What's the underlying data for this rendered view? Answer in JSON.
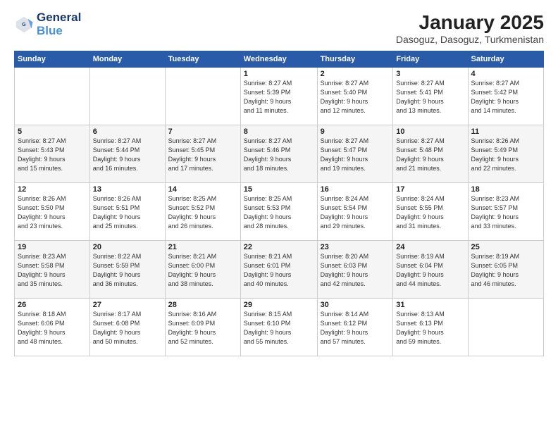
{
  "logo": {
    "line1": "General",
    "line2": "Blue"
  },
  "title": "January 2025",
  "subtitle": "Dasoguz, Dasoguz, Turkmenistan",
  "weekdays": [
    "Sunday",
    "Monday",
    "Tuesday",
    "Wednesday",
    "Thursday",
    "Friday",
    "Saturday"
  ],
  "weeks": [
    [
      {
        "day": "",
        "info": ""
      },
      {
        "day": "",
        "info": ""
      },
      {
        "day": "",
        "info": ""
      },
      {
        "day": "1",
        "info": "Sunrise: 8:27 AM\nSunset: 5:39 PM\nDaylight: 9 hours\nand 11 minutes."
      },
      {
        "day": "2",
        "info": "Sunrise: 8:27 AM\nSunset: 5:40 PM\nDaylight: 9 hours\nand 12 minutes."
      },
      {
        "day": "3",
        "info": "Sunrise: 8:27 AM\nSunset: 5:41 PM\nDaylight: 9 hours\nand 13 minutes."
      },
      {
        "day": "4",
        "info": "Sunrise: 8:27 AM\nSunset: 5:42 PM\nDaylight: 9 hours\nand 14 minutes."
      }
    ],
    [
      {
        "day": "5",
        "info": "Sunrise: 8:27 AM\nSunset: 5:43 PM\nDaylight: 9 hours\nand 15 minutes."
      },
      {
        "day": "6",
        "info": "Sunrise: 8:27 AM\nSunset: 5:44 PM\nDaylight: 9 hours\nand 16 minutes."
      },
      {
        "day": "7",
        "info": "Sunrise: 8:27 AM\nSunset: 5:45 PM\nDaylight: 9 hours\nand 17 minutes."
      },
      {
        "day": "8",
        "info": "Sunrise: 8:27 AM\nSunset: 5:46 PM\nDaylight: 9 hours\nand 18 minutes."
      },
      {
        "day": "9",
        "info": "Sunrise: 8:27 AM\nSunset: 5:47 PM\nDaylight: 9 hours\nand 19 minutes."
      },
      {
        "day": "10",
        "info": "Sunrise: 8:27 AM\nSunset: 5:48 PM\nDaylight: 9 hours\nand 21 minutes."
      },
      {
        "day": "11",
        "info": "Sunrise: 8:26 AM\nSunset: 5:49 PM\nDaylight: 9 hours\nand 22 minutes."
      }
    ],
    [
      {
        "day": "12",
        "info": "Sunrise: 8:26 AM\nSunset: 5:50 PM\nDaylight: 9 hours\nand 23 minutes."
      },
      {
        "day": "13",
        "info": "Sunrise: 8:26 AM\nSunset: 5:51 PM\nDaylight: 9 hours\nand 25 minutes."
      },
      {
        "day": "14",
        "info": "Sunrise: 8:25 AM\nSunset: 5:52 PM\nDaylight: 9 hours\nand 26 minutes."
      },
      {
        "day": "15",
        "info": "Sunrise: 8:25 AM\nSunset: 5:53 PM\nDaylight: 9 hours\nand 28 minutes."
      },
      {
        "day": "16",
        "info": "Sunrise: 8:24 AM\nSunset: 5:54 PM\nDaylight: 9 hours\nand 29 minutes."
      },
      {
        "day": "17",
        "info": "Sunrise: 8:24 AM\nSunset: 5:55 PM\nDaylight: 9 hours\nand 31 minutes."
      },
      {
        "day": "18",
        "info": "Sunrise: 8:23 AM\nSunset: 5:57 PM\nDaylight: 9 hours\nand 33 minutes."
      }
    ],
    [
      {
        "day": "19",
        "info": "Sunrise: 8:23 AM\nSunset: 5:58 PM\nDaylight: 9 hours\nand 35 minutes."
      },
      {
        "day": "20",
        "info": "Sunrise: 8:22 AM\nSunset: 5:59 PM\nDaylight: 9 hours\nand 36 minutes."
      },
      {
        "day": "21",
        "info": "Sunrise: 8:21 AM\nSunset: 6:00 PM\nDaylight: 9 hours\nand 38 minutes."
      },
      {
        "day": "22",
        "info": "Sunrise: 8:21 AM\nSunset: 6:01 PM\nDaylight: 9 hours\nand 40 minutes."
      },
      {
        "day": "23",
        "info": "Sunrise: 8:20 AM\nSunset: 6:03 PM\nDaylight: 9 hours\nand 42 minutes."
      },
      {
        "day": "24",
        "info": "Sunrise: 8:19 AM\nSunset: 6:04 PM\nDaylight: 9 hours\nand 44 minutes."
      },
      {
        "day": "25",
        "info": "Sunrise: 8:19 AM\nSunset: 6:05 PM\nDaylight: 9 hours\nand 46 minutes."
      }
    ],
    [
      {
        "day": "26",
        "info": "Sunrise: 8:18 AM\nSunset: 6:06 PM\nDaylight: 9 hours\nand 48 minutes."
      },
      {
        "day": "27",
        "info": "Sunrise: 8:17 AM\nSunset: 6:08 PM\nDaylight: 9 hours\nand 50 minutes."
      },
      {
        "day": "28",
        "info": "Sunrise: 8:16 AM\nSunset: 6:09 PM\nDaylight: 9 hours\nand 52 minutes."
      },
      {
        "day": "29",
        "info": "Sunrise: 8:15 AM\nSunset: 6:10 PM\nDaylight: 9 hours\nand 55 minutes."
      },
      {
        "day": "30",
        "info": "Sunrise: 8:14 AM\nSunset: 6:12 PM\nDaylight: 9 hours\nand 57 minutes."
      },
      {
        "day": "31",
        "info": "Sunrise: 8:13 AM\nSunset: 6:13 PM\nDaylight: 9 hours\nand 59 minutes."
      },
      {
        "day": "",
        "info": ""
      }
    ]
  ]
}
